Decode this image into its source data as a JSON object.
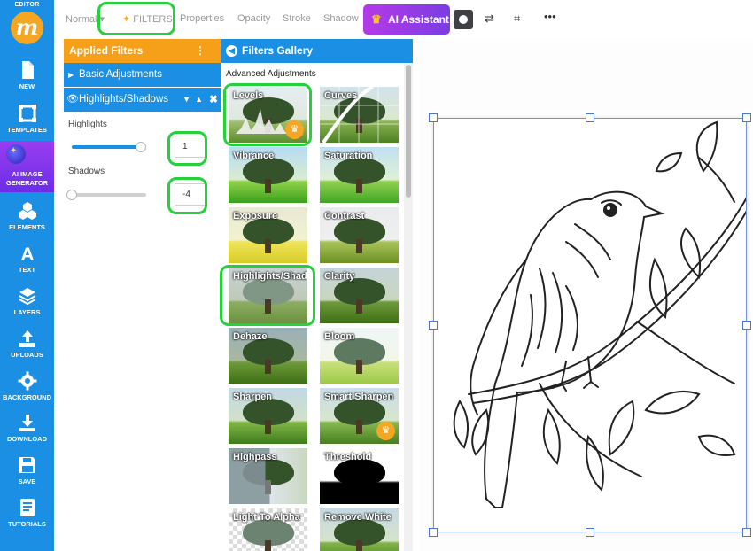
{
  "sidebar": {
    "editor_label": "EDITOR",
    "logo_letter": "m",
    "items": [
      {
        "label": "NEW"
      },
      {
        "label": "TEMPLATES"
      },
      {
        "label": "AI IMAGE GENERATOR"
      },
      {
        "label": "ELEMENTS"
      },
      {
        "label": "TEXT"
      },
      {
        "label": "LAYERS"
      },
      {
        "label": "UPLOADS"
      },
      {
        "label": "BACKGROUND"
      },
      {
        "label": "DOWNLOAD"
      },
      {
        "label": "SAVE"
      },
      {
        "label": "TUTORIALS"
      }
    ]
  },
  "toolbar": {
    "blend_mode": "Normal",
    "filters": "FILTERS",
    "properties": "Properties",
    "opacity": "Opacity",
    "stroke": "Stroke",
    "shadow": "Shadow",
    "ai_assistant": "AI Assistant"
  },
  "applied_filters": {
    "title": "Applied Filters",
    "basic": "Basic Adjustments",
    "highlights_shadows": "Highlights/Shadows",
    "highlights_label": "Highlights",
    "highlights_value": "1",
    "highlights_level": 0.93,
    "shadows_label": "Shadows",
    "shadows_value": "-4",
    "shadows_level": 0.0
  },
  "gallery": {
    "title": "Filters Gallery",
    "section": "Advanced Adjustments",
    "tiles": [
      {
        "label": "Levels",
        "premium": true
      },
      {
        "label": "Curves",
        "premium": false
      },
      {
        "label": "Vibrance",
        "premium": false
      },
      {
        "label": "Saturation",
        "premium": false
      },
      {
        "label": "Exposure",
        "premium": false
      },
      {
        "label": "Contrast",
        "premium": false
      },
      {
        "label": "Highlights/Shadows",
        "premium": false
      },
      {
        "label": "Clarity",
        "premium": false
      },
      {
        "label": "Dehaze",
        "premium": false
      },
      {
        "label": "Bloom",
        "premium": false
      },
      {
        "label": "Sharpen",
        "premium": false
      },
      {
        "label": "Smart Sharpen",
        "premium": true
      },
      {
        "label": "Highpass",
        "premium": false
      },
      {
        "label": "Threshold",
        "premium": false
      },
      {
        "label": "Light To Alpha",
        "premium": false
      },
      {
        "label": "Remove White",
        "premium": false
      }
    ]
  },
  "colors": {
    "sidebar": "#1a8fe3",
    "accent_orange": "#f6a01a",
    "highlight_green": "#25d13b",
    "ai_purple": "#9b3df0"
  }
}
